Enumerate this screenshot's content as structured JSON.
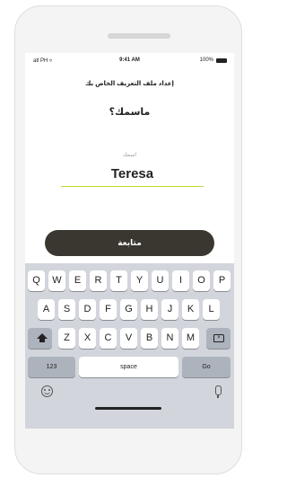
{
  "status": {
    "carrier": "atl PH ▿",
    "time": "9:41 AM",
    "battery": "100%"
  },
  "screen": {
    "header_title": "إعداد ملف التعريف الخاص بك",
    "question": "ماسمك؟",
    "field_label": "اسمك",
    "name_value": "Teresa",
    "continue_label": "متابعة"
  },
  "keyboard": {
    "row1": [
      "Q",
      "W",
      "E",
      "R",
      "T",
      "Y",
      "U",
      "I",
      "O",
      "P"
    ],
    "row2": [
      "A",
      "S",
      "D",
      "F",
      "G",
      "H",
      "J",
      "K",
      "L"
    ],
    "row3": [
      "Z",
      "X",
      "C",
      "V",
      "B",
      "N",
      "M"
    ],
    "numbers_label": "123",
    "space_label": "space",
    "go_label": "Go"
  },
  "icons": {
    "shift": "shift-icon",
    "backspace": "backspace-icon",
    "emoji": "emoji-icon",
    "mic": "microphone-icon"
  },
  "colors": {
    "button": "#3a3730",
    "underline": "#c2d82e",
    "keyboard_bg": "#d2d5db"
  }
}
